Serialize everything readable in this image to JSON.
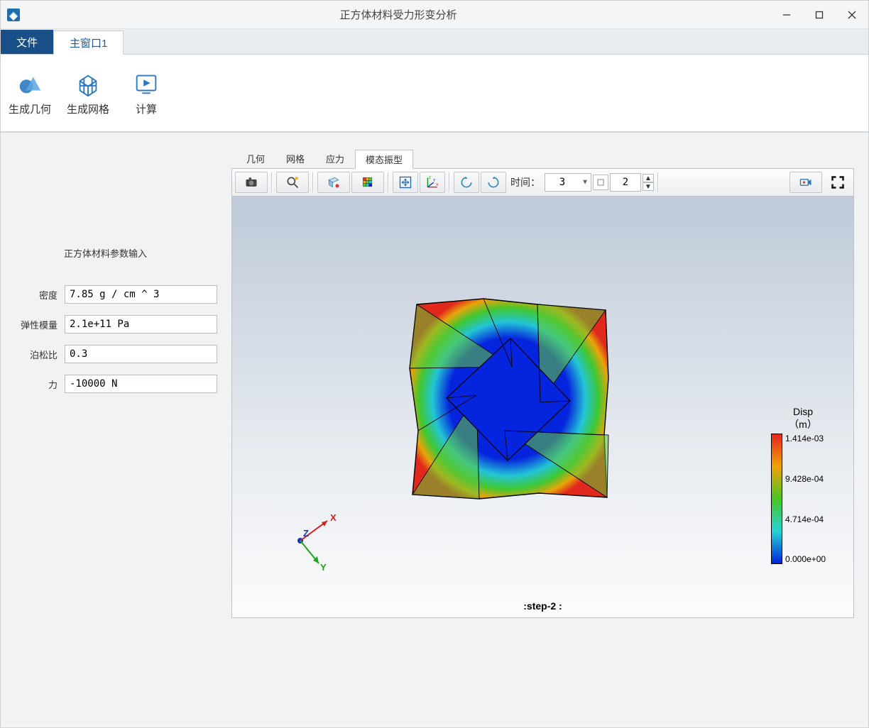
{
  "window": {
    "title": "正方体材料受力形变分析"
  },
  "menubar": {
    "file_label": "文件",
    "tab1_label": "主窗口1"
  },
  "ribbon": {
    "btn_geom": "生成几何",
    "btn_mesh": "生成网格",
    "btn_calc": "计算"
  },
  "leftpanel": {
    "title": "正方体材料参数输入",
    "fields": [
      {
        "label": "密度",
        "value": "7.85 g / cm ^ 3"
      },
      {
        "label": "弹性模量",
        "value": "2.1e+11 Pa"
      },
      {
        "label": "泊松比",
        "value": "0.3"
      },
      {
        "label": "力",
        "value": "-10000 N"
      }
    ]
  },
  "viewtabs": {
    "items": [
      "几何",
      "网格",
      "应力",
      "模态振型"
    ],
    "active_index": 3
  },
  "vtoolbar": {
    "time_label": "时间：",
    "time_value": "3",
    "spin_value": "2"
  },
  "view3d": {
    "step_label": ":step-2 :",
    "triad": {
      "x": "X",
      "y": "Y",
      "z": "Z"
    },
    "colormap": {
      "title_line1": "Disp",
      "title_line2": "（m）",
      "ticks": [
        "1.414e-03",
        "9.428e-04",
        "4.714e-04",
        "0.000e+00"
      ]
    }
  }
}
